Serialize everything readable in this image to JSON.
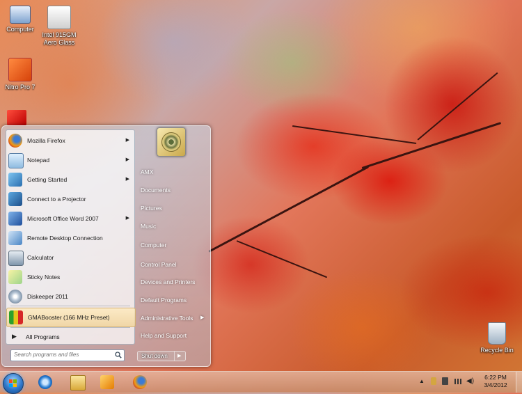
{
  "desktop": {
    "icons": [
      {
        "label": "Computer",
        "icon": "computer-icon"
      },
      {
        "label": "Intel 915GM Aero Glass",
        "icon": "intel-icon"
      },
      {
        "label": "Nitro Pro 7",
        "icon": "nitro-icon"
      },
      {
        "label": "Recycle Bin",
        "icon": "recycle-bin-icon"
      }
    ]
  },
  "start_menu": {
    "programs": [
      {
        "label": "Mozilla Firefox",
        "has_submenu": true,
        "icon": "firefox-icon"
      },
      {
        "label": "Notepad",
        "has_submenu": true,
        "icon": "notepad-icon"
      },
      {
        "label": "Getting Started",
        "has_submenu": true,
        "icon": "getting-started-icon"
      },
      {
        "label": "Connect to a Projector",
        "has_submenu": false,
        "icon": "projector-icon"
      },
      {
        "label": "Microsoft Office Word 2007",
        "has_submenu": true,
        "icon": "word-icon"
      },
      {
        "label": "Remote Desktop Connection",
        "has_submenu": false,
        "icon": "remote-desktop-icon"
      },
      {
        "label": "Calculator",
        "has_submenu": false,
        "icon": "calculator-icon"
      },
      {
        "label": "Sticky Notes",
        "has_submenu": false,
        "icon": "sticky-notes-icon"
      },
      {
        "label": "Diskeeper 2011",
        "has_submenu": false,
        "icon": "diskeeper-icon"
      },
      {
        "label": "GMABooster (166 MHz Preset)",
        "has_submenu": false,
        "icon": "gmabooster-icon",
        "highlighted": true
      }
    ],
    "all_programs_label": "All Programs",
    "search_placeholder": "Search programs and files",
    "right_items": [
      {
        "label": "AMX",
        "has_submenu": false
      },
      {
        "label": "Documents",
        "has_submenu": false
      },
      {
        "label": "Pictures",
        "has_submenu": false
      },
      {
        "label": "Music",
        "has_submenu": false
      },
      {
        "label": "Computer",
        "has_submenu": false
      },
      {
        "label": "Control Panel",
        "has_submenu": false
      },
      {
        "label": "Devices and Printers",
        "has_submenu": false
      },
      {
        "label": "Default Programs",
        "has_submenu": false
      },
      {
        "label": "Administrative Tools",
        "has_submenu": true
      },
      {
        "label": "Help and Support",
        "has_submenu": false
      }
    ],
    "shutdown_label": "Shut down"
  },
  "taskbar": {
    "pinned": [
      {
        "name": "internet-explorer",
        "icon": "ie-icon"
      },
      {
        "name": "windows-explorer",
        "icon": "folder-icon"
      },
      {
        "name": "media-player",
        "icon": "media-player-icon"
      },
      {
        "name": "firefox",
        "icon": "firefox-icon"
      }
    ],
    "clock_time": "6:22 PM",
    "clock_date": "3/4/2012"
  }
}
